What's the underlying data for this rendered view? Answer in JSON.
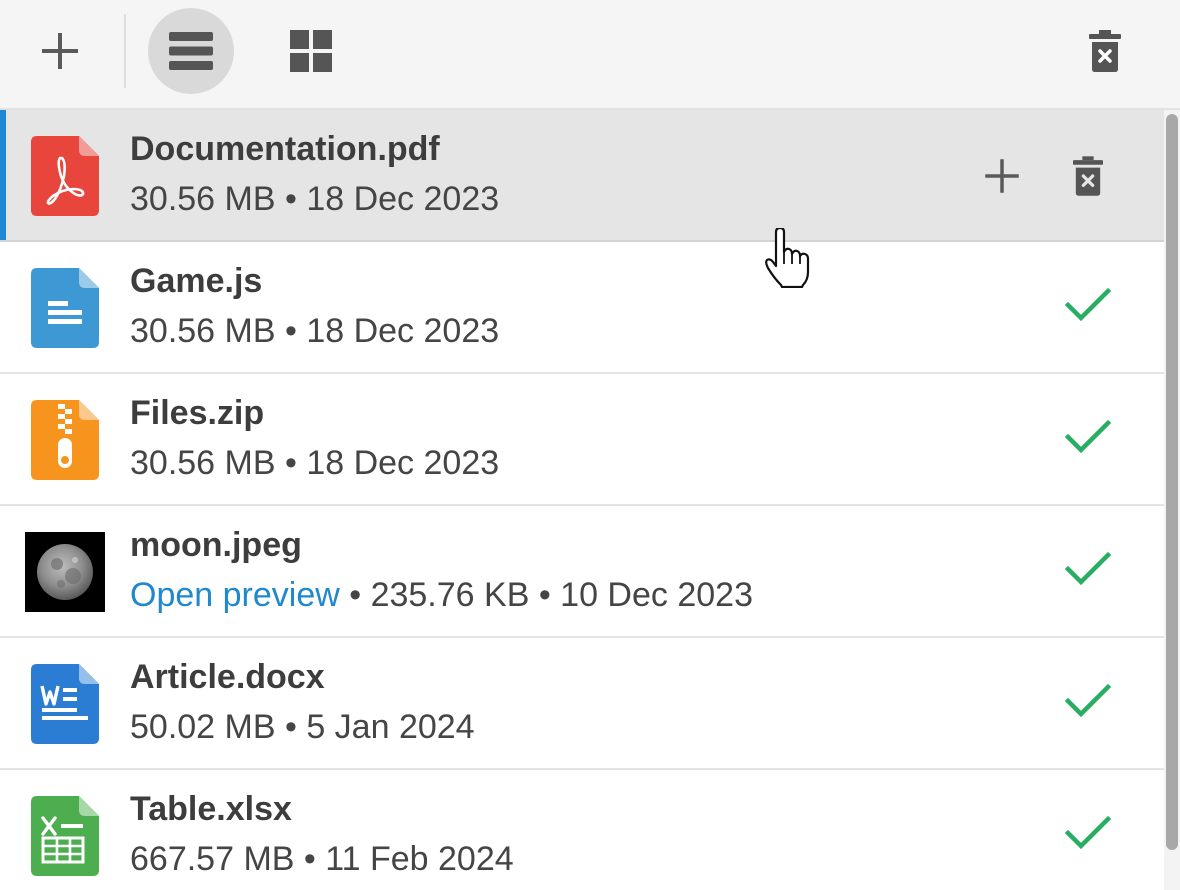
{
  "toolbar": {
    "add_icon": "plus-icon",
    "list_view_icon": "list-view-icon",
    "grid_view_icon": "grid-view-icon",
    "clear_icon": "trash-icon",
    "active_view": "list"
  },
  "colors": {
    "accent": "#1e87d6",
    "link": "#1f88cf",
    "success": "#27ae60",
    "pdf": "#e8453c",
    "js": "#3d98d3",
    "zip": "#f7941d",
    "docx": "#2b7cd3",
    "xlsx": "#4cae4f"
  },
  "files": [
    {
      "name": "Documentation.pdf",
      "size": "30.56 MB",
      "sep": " • ",
      "date": "18 Dec 2023",
      "icon": "pdf-file-icon",
      "status": "hover"
    },
    {
      "name": "Game.js",
      "size": "30.56 MB",
      "sep": " • ",
      "date": "18 Dec 2023",
      "icon": "document-file-icon",
      "status": "uploaded"
    },
    {
      "name": "Files.zip",
      "size": "30.56 MB",
      "sep": " • ",
      "date": "18 Dec 2023",
      "icon": "zip-file-icon",
      "status": "uploaded"
    },
    {
      "name": "moon.jpeg",
      "preview_label": "Open preview",
      "size": "235.76 KB",
      "sep": " • ",
      "date": "10 Dec 2023",
      "icon": "moon-thumbnail",
      "status": "uploaded"
    },
    {
      "name": "Article.docx",
      "size": "50.02 MB",
      "sep": " • ",
      "date": "5 Jan 2024",
      "icon": "word-file-icon",
      "status": "uploaded"
    },
    {
      "name": "Table.xlsx",
      "size": "667.57 MB",
      "sep": " • ",
      "date": "11 Feb 2024",
      "icon": "excel-file-icon",
      "status": "uploaded"
    }
  ]
}
